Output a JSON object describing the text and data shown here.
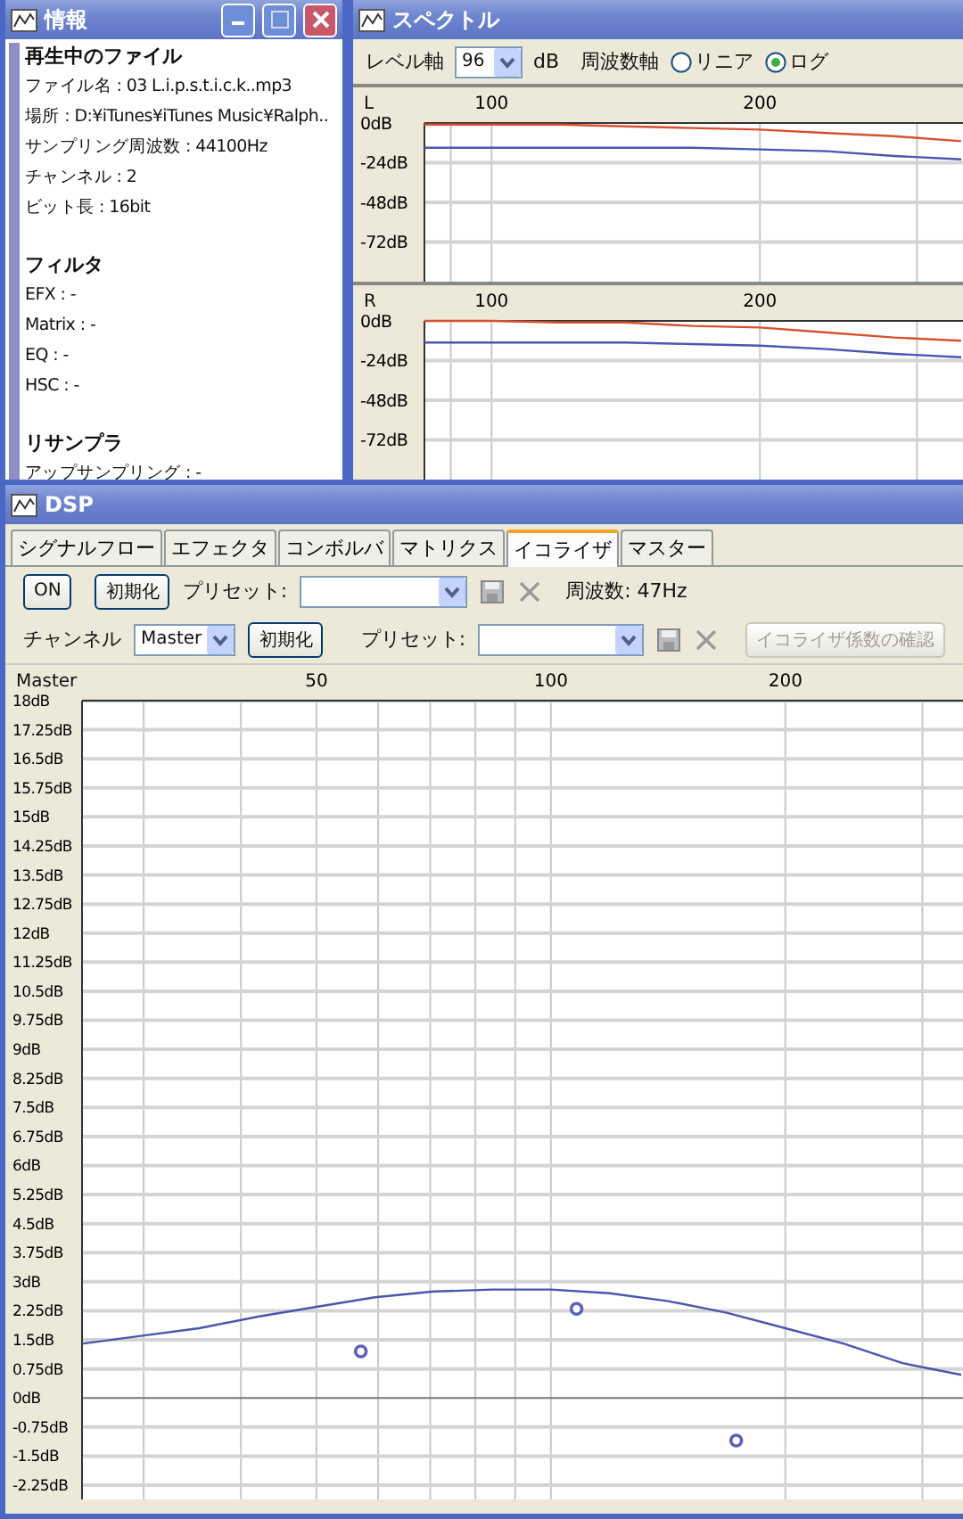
{
  "info_window": {
    "title": "情報",
    "sections": [
      {
        "heading": "再生中のファイル",
        "lines": [
          "ファイル名 : 03 L.i.p.s.t.i.c.k..mp3",
          "場所 : D:¥iTunes¥iTunes Music¥Ralph..",
          "サンプリング周波数 : 44100Hz",
          "チャンネル : 2",
          "ビット長 : 16bit"
        ]
      },
      {
        "heading": "フィルタ",
        "lines": [
          "EFX : -",
          "Matrix : -",
          "EQ : -",
          "HSC : -"
        ]
      },
      {
        "heading": "リサンプラ",
        "lines": [
          "アップサンプリング : -"
        ]
      }
    ]
  },
  "spectrum_window": {
    "title": "スペクトル",
    "level_axis_label": "レベル軸",
    "level_select": "96",
    "level_unit": "dB",
    "freq_axis_label": "周波数軸",
    "scale_options": [
      {
        "label": "リニア",
        "selected": false
      },
      {
        "label": "ログ",
        "selected": true
      }
    ],
    "charts": [
      {
        "chart_data": {
          "type": "line",
          "title": "L",
          "grid": true,
          "categories": [
            null,
            "100",
            null,
            null,
            null,
            "200",
            null,
            null,
            null
          ],
          "ylim": [
            -96,
            0
          ],
          "yticks": [
            {
              "value": 0,
              "label": "0dB"
            },
            {
              "value": -24,
              "label": "-24dB"
            },
            {
              "value": -48,
              "label": "-48dB"
            },
            {
              "value": -72,
              "label": "-72dB"
            }
          ],
          "series": [
            {
              "color": "#d9502e",
              "values": [
                -1,
                -1,
                -1,
                -2,
                -3,
                -4,
                -6,
                -8,
                -11
              ]
            },
            {
              "color": "#4a55b0",
              "values": [
                -15,
                -15,
                -15,
                -15,
                -15,
                -16,
                -17,
                -20,
                -22
              ]
            }
          ]
        }
      },
      {
        "chart_data": {
          "type": "line",
          "title": "R",
          "grid": true,
          "categories": [
            null,
            "100",
            null,
            null,
            null,
            "200",
            null,
            null,
            null
          ],
          "ylim": [
            -96,
            0
          ],
          "yticks": [
            {
              "value": 0,
              "label": "0dB"
            },
            {
              "value": -24,
              "label": "-24dB"
            },
            {
              "value": -48,
              "label": "-48dB"
            },
            {
              "value": -72,
              "label": "-72dB"
            }
          ],
          "series": [
            {
              "color": "#d9502e",
              "values": [
                0,
                0,
                -1,
                -1,
                -3,
                -4,
                -7,
                -10,
                -12
              ]
            },
            {
              "color": "#4a55b0",
              "values": [
                -13,
                -13,
                -13,
                -13,
                -14,
                -15,
                -17,
                -20,
                -22
              ]
            }
          ]
        }
      }
    ]
  },
  "dsp_window": {
    "title": "DSP",
    "tabs": [
      {
        "label": "シグナルフロー",
        "selected": false
      },
      {
        "label": "エフェクタ",
        "selected": false
      },
      {
        "label": "コンボルバ",
        "selected": false
      },
      {
        "label": "マトリクス",
        "selected": false
      },
      {
        "label": "イコライザ",
        "selected": true
      },
      {
        "label": "マスター",
        "selected": false
      }
    ],
    "top_row": {
      "on_button": "ON",
      "reset_button": "初期化",
      "preset_label": "プリセット:",
      "frequency": "周波数: 47Hz"
    },
    "channel_row": {
      "channel_label": "チャンネル",
      "channel_select": "Master",
      "reset_button": "初期化",
      "preset_label": "プリセット:",
      "confirm_button": {
        "label": "イコライザ係数の確認",
        "disabled": true
      }
    },
    "chart_data": {
      "type": "line",
      "title": "Master",
      "grid": true,
      "categories": [
        null,
        null,
        null,
        null,
        "50",
        null,
        null,
        null,
        "100",
        null,
        null,
        null,
        "200",
        null,
        null,
        null
      ],
      "ylim": [
        -2.25,
        18
      ],
      "yticks": [
        {
          "value": 18,
          "label": "18dB"
        },
        {
          "value": 17.25,
          "label": "17.25dB"
        },
        {
          "value": 16.5,
          "label": "16.5dB"
        },
        {
          "value": 15.75,
          "label": "15.75dB"
        },
        {
          "value": 15,
          "label": "15dB"
        },
        {
          "value": 14.25,
          "label": "14.25dB"
        },
        {
          "value": 13.5,
          "label": "13.5dB"
        },
        {
          "value": 12.75,
          "label": "12.75dB"
        },
        {
          "value": 12,
          "label": "12dB"
        },
        {
          "value": 11.25,
          "label": "11.25dB"
        },
        {
          "value": 10.5,
          "label": "10.5dB"
        },
        {
          "value": 9.75,
          "label": "9.75dB"
        },
        {
          "value": 9,
          "label": "9dB"
        },
        {
          "value": 8.25,
          "label": "8.25dB"
        },
        {
          "value": 7.5,
          "label": "7.5dB"
        },
        {
          "value": 6.75,
          "label": "6.75dB"
        },
        {
          "value": 6,
          "label": "6dB"
        },
        {
          "value": 5.25,
          "label": "5.25dB"
        },
        {
          "value": 4.5,
          "label": "4.5dB"
        },
        {
          "value": 3.75,
          "label": "3.75dB"
        },
        {
          "value": 3,
          "label": "3dB"
        },
        {
          "value": 2.25,
          "label": "2.25dB"
        },
        {
          "value": 1.5,
          "label": "1.5dB"
        },
        {
          "value": 0.75,
          "label": "0.75dB"
        },
        {
          "value": 0,
          "label": "0dB"
        },
        {
          "value": -0.75,
          "label": "-0.75dB"
        },
        {
          "value": -1.5,
          "label": "-1.5dB"
        },
        {
          "value": -2.25,
          "label": "-2.25dB"
        }
      ],
      "series": [
        {
          "color": "#4a55b0",
          "values": [
            1.4,
            1.6,
            1.8,
            2.1,
            2.35,
            2.6,
            2.75,
            2.8,
            2.8,
            2.7,
            2.5,
            2.2,
            1.8,
            1.4,
            0.9,
            0.6
          ]
        }
      ]
    }
  }
}
